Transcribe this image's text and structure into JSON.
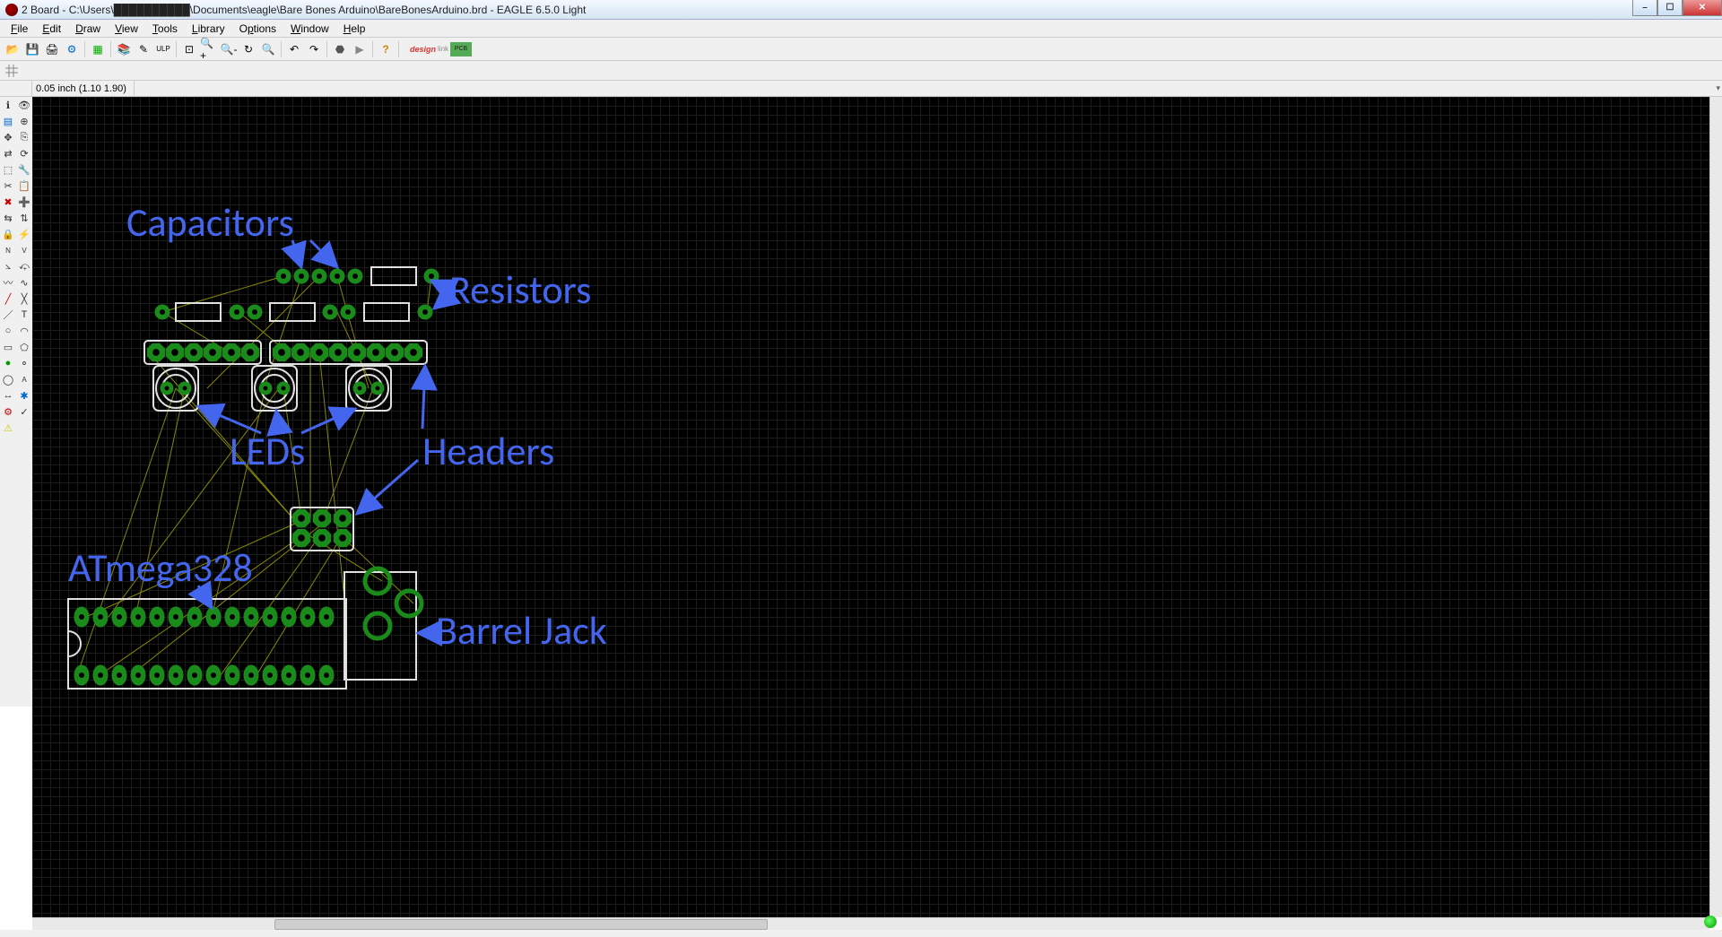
{
  "window": {
    "title": "2 Board - C:\\Users\\██████████\\Documents\\eagle\\Bare Bones Arduino\\BareBonesArduino.brd - EAGLE 6.5.0 Light"
  },
  "menus": [
    "File",
    "Edit",
    "Draw",
    "View",
    "Tools",
    "Library",
    "Options",
    "Window",
    "Help"
  ],
  "coord": {
    "text": "0.05 inch (1.10 1.90)"
  },
  "annotations": {
    "capacitors": "Capacitors",
    "resistors": "Resistors",
    "leds": "LEDs",
    "headers": "Headers",
    "atmega": "ATmega328",
    "barrel": "Barrel Jack"
  },
  "toolbar1_icons": [
    "open-icon",
    "save-icon",
    "print-icon",
    "cam-icon",
    "sep",
    "board-schem-icon",
    "sep",
    "sheet-prior-icon",
    "sheet-next-icon",
    "undo-icon",
    "redo-icon",
    "sep",
    "zoom-fit-icon",
    "zoom-in-icon",
    "zoom-out-icon",
    "zoom-redraw-icon",
    "zoom-select-icon",
    "sep",
    "stop-icon",
    "go-icon",
    "sep",
    "help-icon"
  ],
  "toolpalette_icons": [
    "info-icon",
    "show-icon",
    "display-icon",
    "mark-icon",
    "move-icon",
    "copy-icon",
    "mirror-icon",
    "rotate-icon",
    "group-icon",
    "change-icon",
    "cut-icon",
    "paste-icon",
    "delete-icon",
    "add-icon",
    "pinswap-icon",
    "replace-icon",
    "lock-icon",
    "smash-icon",
    "name-icon",
    "value-icon",
    "miter-icon",
    "split-icon",
    "optimize-icon",
    "meander-icon",
    "route-icon",
    "ripup-icon",
    "wire-icon",
    "text-icon",
    "circle-icon",
    "arc-icon",
    "rect-icon",
    "polygon-icon",
    "via-icon",
    "signal-icon",
    "hole-icon",
    "attribute-icon",
    "dimension-icon",
    "ratsnest-icon",
    "auto-icon",
    "erc-icon",
    "errors-icon",
    ""
  ]
}
